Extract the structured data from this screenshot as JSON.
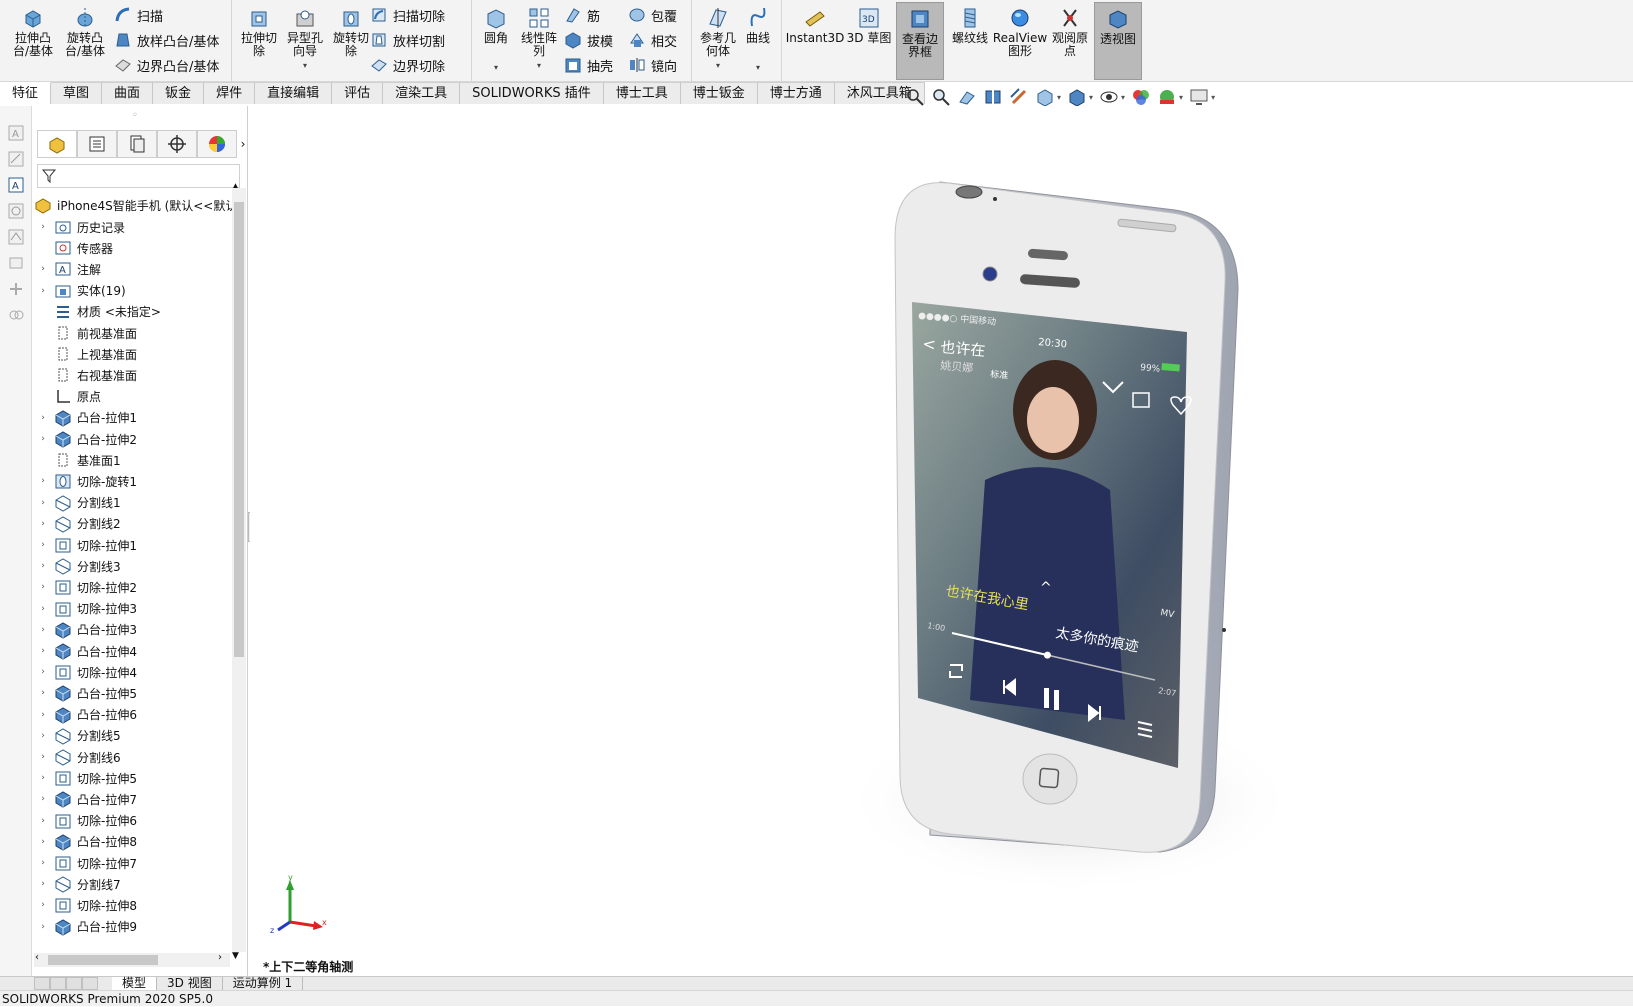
{
  "ribbon": {
    "extrude_boss": "拉伸凸\n台/基体",
    "revolve_boss": "旋转凸\n台/基体",
    "sweep": "扫描",
    "loft_boss": "放样凸台/基体",
    "boundary_boss": "边界凸台/基体",
    "extrude_cut": "拉伸切\n除",
    "hole_wizard": "异型孔\n向导",
    "revolve_cut": "旋转切\n除",
    "sweep_cut": "扫描切除",
    "loft_cut": "放样切割",
    "boundary_cut": "边界切除",
    "fillet": "圆角",
    "linear_pattern": "线性阵\n列",
    "rib": "筋",
    "draft": "拔模",
    "shell": "抽壳",
    "wrap": "包覆",
    "intersect": "相交",
    "mirror": "镜向",
    "ref_geometry": "参考几\n何体",
    "curves": "曲线",
    "instant3d": "Instant3D",
    "sketch3d": "3D 草图",
    "bounding_box": "查看边\n界框",
    "thread": "螺纹线",
    "realview": "RealView\n图形",
    "view_origins": "观阅原\n点",
    "perspective": "透视图"
  },
  "tabs": [
    "特征",
    "草图",
    "曲面",
    "钣金",
    "焊件",
    "直接编辑",
    "评估",
    "渲染工具",
    "SOLIDWORKS 插件",
    "博士工具",
    "博士钣金",
    "博士方通",
    "沐风工具箱"
  ],
  "tree": {
    "root": "iPhone4S智能手机 (默认<<默认",
    "items": [
      {
        "label": "历史记录",
        "icon": "history-folder-icon",
        "expand": true
      },
      {
        "label": "传感器",
        "icon": "sensor-icon",
        "expand": false
      },
      {
        "label": "注解",
        "icon": "annotation-icon",
        "expand": true
      },
      {
        "label": "实体(19)",
        "icon": "solid-bodies-folder-icon",
        "expand": true
      },
      {
        "label": "材质 <未指定>",
        "icon": "material-icon",
        "expand": false
      },
      {
        "label": "前视基准面",
        "icon": "plane-icon",
        "expand": false
      },
      {
        "label": "上视基准面",
        "icon": "plane-icon",
        "expand": false
      },
      {
        "label": "右视基准面",
        "icon": "plane-icon",
        "expand": false
      },
      {
        "label": "原点",
        "icon": "origin-icon",
        "expand": false
      },
      {
        "label": "凸台-拉伸1",
        "icon": "boss-extrude-icon",
        "expand": true
      },
      {
        "label": "凸台-拉伸2",
        "icon": "boss-extrude-icon",
        "expand": true
      },
      {
        "label": "基准面1",
        "icon": "plane-icon",
        "expand": false
      },
      {
        "label": "切除-旋转1",
        "icon": "cut-revolve-icon",
        "expand": true
      },
      {
        "label": "分割线1",
        "icon": "split-line-icon",
        "expand": true
      },
      {
        "label": "分割线2",
        "icon": "split-line-icon",
        "expand": true
      },
      {
        "label": "切除-拉伸1",
        "icon": "cut-extrude-icon",
        "expand": true
      },
      {
        "label": "分割线3",
        "icon": "split-line-icon",
        "expand": true
      },
      {
        "label": "切除-拉伸2",
        "icon": "cut-extrude-icon",
        "expand": true
      },
      {
        "label": "切除-拉伸3",
        "icon": "cut-extrude-icon",
        "expand": true
      },
      {
        "label": "凸台-拉伸3",
        "icon": "boss-extrude-icon",
        "expand": true
      },
      {
        "label": "凸台-拉伸4",
        "icon": "boss-extrude-icon",
        "expand": true
      },
      {
        "label": "切除-拉伸4",
        "icon": "cut-extrude-icon",
        "expand": true
      },
      {
        "label": "凸台-拉伸5",
        "icon": "boss-extrude-icon",
        "expand": true
      },
      {
        "label": "凸台-拉伸6",
        "icon": "boss-extrude-icon",
        "expand": true
      },
      {
        "label": "分割线5",
        "icon": "split-line-icon",
        "expand": true
      },
      {
        "label": "分割线6",
        "icon": "split-line-icon",
        "expand": true
      },
      {
        "label": "切除-拉伸5",
        "icon": "cut-extrude-icon",
        "expand": true
      },
      {
        "label": "凸台-拉伸7",
        "icon": "boss-extrude-icon",
        "expand": true
      },
      {
        "label": "切除-拉伸6",
        "icon": "cut-extrude-icon",
        "expand": true
      },
      {
        "label": "凸台-拉伸8",
        "icon": "boss-extrude-icon",
        "expand": true
      },
      {
        "label": "切除-拉伸7",
        "icon": "cut-extrude-icon",
        "expand": true
      },
      {
        "label": "分割线7",
        "icon": "split-line-icon",
        "expand": true
      },
      {
        "label": "切除-拉伸8",
        "icon": "cut-extrude-icon",
        "expand": true
      },
      {
        "label": "凸台-拉伸9",
        "icon": "boss-extrude-icon",
        "expand": true
      }
    ]
  },
  "phone_screen": {
    "carrier": "●●●●○ 中国移动",
    "time": "20:30",
    "battery": "99%",
    "song_title": "也许在",
    "artist": "姚贝娜",
    "quality_badge": "标准",
    "lyric_current": "也许在我心里",
    "lyric_next": "太多你的痕迹",
    "elapsed": "1:00",
    "duration": "2:07",
    "mv_badge": "MV",
    "progress_fraction": 0.47
  },
  "triad": {
    "x": "x",
    "y": "y",
    "z": "z"
  },
  "view_name": "*上下二等角轴测",
  "bottom_tabs": [
    "模型",
    "3D 视图",
    "运动算例 1"
  ],
  "status": "SOLIDWORKS Premium 2020 SP5.0",
  "colors": {
    "ribbon_bg": "#f3f3f3",
    "active_button": "#b9b9b9",
    "phone_body": "#e9e9e9",
    "phone_frame": "#a8acb8",
    "accent_blue": "#2a6fd6"
  }
}
